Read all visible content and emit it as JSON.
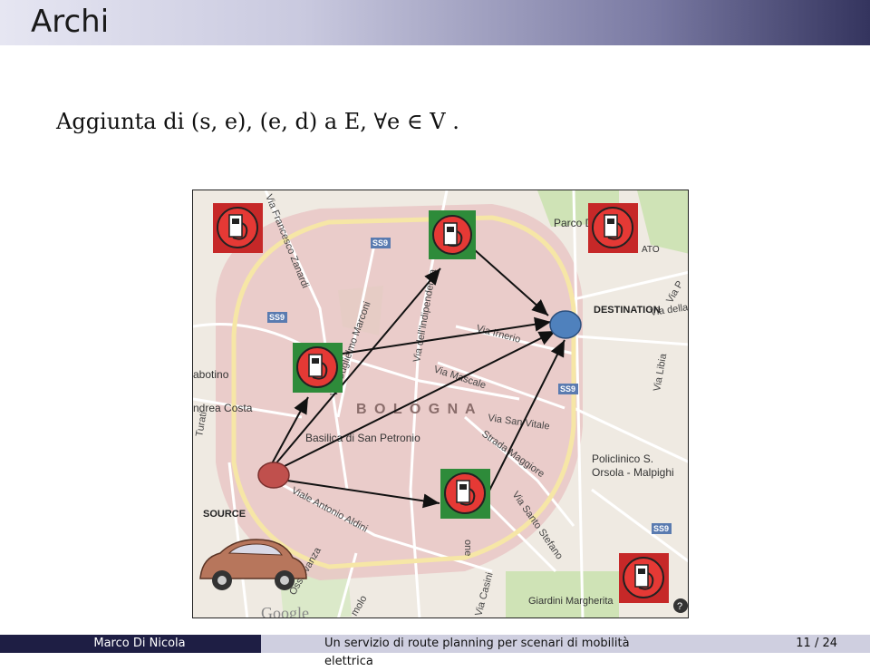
{
  "slide": {
    "title": "Archi",
    "body": "Aggiunta di (s, e), (e, d) a E,   ∀e ∈ V ."
  },
  "map": {
    "labels": {
      "destination": "DESTINATION",
      "source": "SOURCE",
      "city": "B O L O G N A",
      "parco": "Parco De",
      "ato": "ATO",
      "via_francesco": "Via Francesco Zanardi",
      "via_guglielmo": "Via Guglielmo Marconi",
      "via_indipendenza": "Via dell'Indipendenza",
      "via_irnerio": "Via Irnerio",
      "via_mascale": "Via Mascale",
      "via_san_vitale": "Via San Vitale",
      "strada_maggiore": "Strada Maggiore",
      "via_santo_stefano": "Via Santo Stefano",
      "viale_aldini": "Viale Antonio Aldini",
      "basilica": "Basilica di San Petronio",
      "policlinico": "Policlinico S.",
      "orsola": "Orsola - Malpighi",
      "via_libia": "Via Libia",
      "via_della": "Via della",
      "via_p": "Via P",
      "giardini": "Giardini Margherita",
      "via_casini": "Via Casini",
      "andrea_costa": "ndrea Costa",
      "sabotino": "abotino",
      "torti": "Turati",
      "osservanza": "Osservanza",
      "molo": "molo",
      "one": "one",
      "google": "Google",
      "ss9_1": "SS9",
      "ss9_2": "SS9",
      "ss9_3": "SS9",
      "ss9_4": "SS9"
    }
  },
  "footer": {
    "author": "Marco Di Nicola",
    "talk_title": "Un servizio di route planning per scenari di mobilità elettrica",
    "page": "11 / 24"
  },
  "colors": {
    "source_node": "#c0504d",
    "destination_node": "#4f81bd",
    "station_green": "#2e8b3a",
    "station_red": "#c62828"
  }
}
